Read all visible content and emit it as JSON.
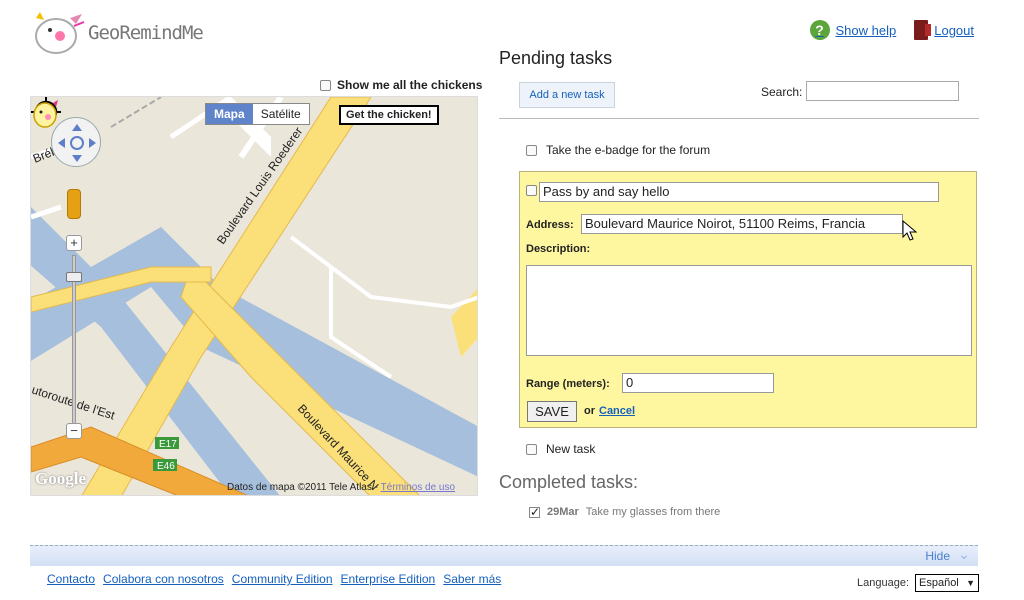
{
  "app": {
    "name": "GeoRemindMe"
  },
  "header": {
    "help_label": "Show help",
    "logout_label": "Logout"
  },
  "map": {
    "show_all_label": "Show me all the chickens",
    "type_buttons": [
      "Mapa",
      "Satélite"
    ],
    "get_chicken_label": "Get the chicken!",
    "street_labels": [
      "Boulevard Louis Roederer",
      "Brébant",
      "Boulevard Maurice N",
      "utoroute de l'Est"
    ],
    "road_badges": [
      "E17",
      "E46"
    ],
    "google_label": "Google",
    "attribution": "Datos de mapa ©2011 Tele Atlas - ",
    "terms_label": "Términos de uso"
  },
  "tasks": {
    "pending_title": "Pending tasks",
    "add_task_label": "Add a new task",
    "search_label": "Search:",
    "search_value": "",
    "items": [
      "Take the e-badge for the forum",
      "New task"
    ],
    "editor": {
      "name_value": "Pass by and say hello",
      "address_label": "Address:",
      "address_value": "Boulevard Maurice Noirot, 51100 Reims, Francia",
      "description_label": "Description:",
      "description_value": "",
      "range_label": "Range (meters):",
      "range_value": "0",
      "save_label": "SAVE",
      "or_label": "or",
      "cancel_label": "Cancel"
    },
    "completed_title": "Completed tasks:",
    "completed": [
      {
        "date": "29Mar",
        "text": "Take my glasses from there"
      }
    ]
  },
  "footer": {
    "hide_label": "Hide",
    "links": [
      "Contacto",
      "Colabora con nosotros",
      "Community Edition",
      "Enterprise Edition",
      "Saber más"
    ],
    "language_label": "Language:",
    "language_value": "Español"
  }
}
